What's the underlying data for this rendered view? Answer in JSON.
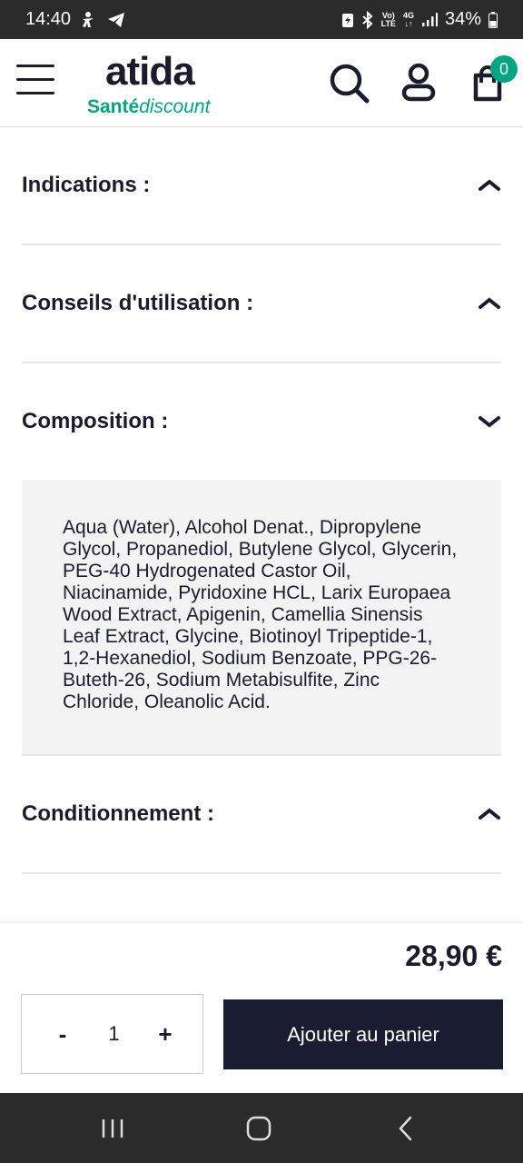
{
  "status_bar": {
    "time": "14:40",
    "battery": "34%",
    "volte_top": "Vo)",
    "volte_bottom": "LTE",
    "net_top": "4G",
    "net_bottom": "↓↑"
  },
  "header": {
    "logo_top": "atida",
    "logo_bold": "Santé",
    "logo_italic": "discount",
    "cart_count": "0",
    "brand_color": "#00a581"
  },
  "accordion": [
    {
      "title": "Indications :",
      "state": "collapsed"
    },
    {
      "title": "Conseils d'utilisation :",
      "state": "collapsed"
    },
    {
      "title": "Composition :",
      "state": "expanded",
      "body": "Aqua (Water), Alcohol Denat., Dipropylene Glycol, Propanediol, Butylene Glycol, Glycerin, PEG-40 Hydrogenated Castor Oil, Niacinamide, Pyridoxine HCL, Larix Europaea Wood Extract, Apigenin, Camellia Sinensis Leaf Extract, Glycine, Biotinoyl Tripeptide-1, 1,2-Hexanediol, Sodium Benzoate, PPG-26-Buteth-26, Sodium Metabisulfite, Zinc Chloride, Oleanolic Acid."
    },
    {
      "title": "Conditionnement :",
      "state": "collapsed"
    }
  ],
  "purchase": {
    "price": "28,90 €",
    "minus": "-",
    "quantity": "1",
    "plus": "+",
    "add_to_cart": "Ajouter au panier"
  }
}
